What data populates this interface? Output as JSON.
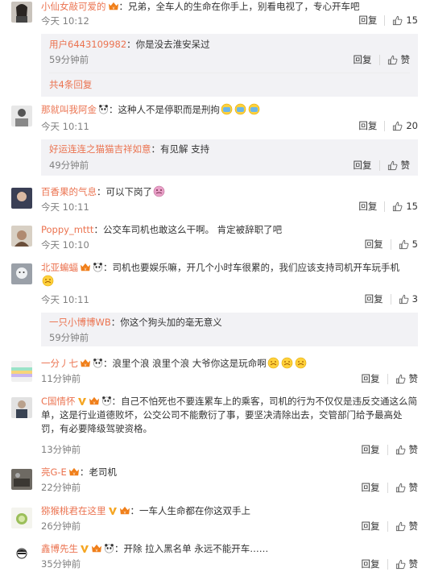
{
  "comments": [
    {
      "user": "小仙女敲可爱的",
      "text": "：兄弟，全车人的生命在你手上，别看电视了，专心开车吧",
      "time": "今天 10:12",
      "reply": "回复",
      "likes": "15",
      "subs": [
        {
          "user": "用户6443109982",
          "text": "：你是没去淮安呆过",
          "time": "59分钟前",
          "reply": "回复",
          "like": "赞"
        }
      ],
      "more": "共4条回复"
    },
    {
      "user": "那就叫我阿金",
      "text": "：这种人不是停职而是刑拘",
      "time": "今天 10:11",
      "reply": "回复",
      "likes": "20",
      "subs": [
        {
          "user": "好运连连之猫猫吉祥如意",
          "text": "：有见解 支持",
          "time": "49分钟前",
          "reply": "回复",
          "like": "赞"
        }
      ]
    },
    {
      "user": "百香果的气息",
      "text": "：可以下岗了",
      "time": "今天 10:11",
      "reply": "回复",
      "likes": "15"
    },
    {
      "user": "Poppy_mttt",
      "text": "：公交车司机也敢这么干啊。 肯定被辞职了吧",
      "time": "今天 10:10",
      "reply": "回复",
      "likes": "5"
    },
    {
      "user": "北亚蝙蝠",
      "text": "：司机也要娱乐嘛，开几个小时车很累的，我们应该支持司机开车玩手机",
      "time": "今天 10:11",
      "reply": "回复",
      "likes": "3",
      "subs": [
        {
          "user": "一只小博博WB",
          "text": "：你这个狗头加的毫无意义",
          "time": "59分钟前",
          "reply": "回复",
          "like": "赞"
        }
      ]
    },
    {
      "user": "一分丿七",
      "text": "：浪里个浪 浪里个浪 大爷你这是玩命啊",
      "time": "11分钟前",
      "reply": "回复",
      "likes": "赞"
    },
    {
      "user": "C国情怀",
      "text": "：自己不怕死也不要连累车上的乘客，司机的行为不仅仅是违反交通这么简单，这是行业道德败坏，公交公司不能敷衍了事，要坚决清除出去，交管部门给予最高处罚，有必要降级驾驶资格。",
      "time": "13分钟前",
      "reply": "回复",
      "likes": "赞"
    },
    {
      "user": "亮G-E",
      "text": "：老司机",
      "time": "22分钟前",
      "reply": "回复",
      "likes": "赞"
    },
    {
      "user": "猕猴桃君在这里",
      "text": "：一车人生命都在你这双手上",
      "time": "26分钟前",
      "reply": "回复",
      "likes": "赞"
    },
    {
      "user": "鑫博先生",
      "text": "：开除 拉入黑名单 永远不能开车……",
      "time": "35分钟前",
      "reply": "回复",
      "likes": "赞"
    }
  ],
  "colors": {
    "username": "#eb7350",
    "subbg": "#f2f2f5",
    "meta": "#808080"
  },
  "icons": [
    "thumbs-up-icon",
    "vip-badge-icon",
    "panda-emoji-icon",
    "vip-v-icon"
  ]
}
